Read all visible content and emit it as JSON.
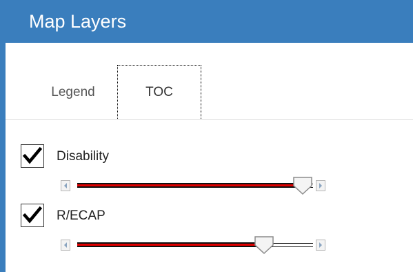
{
  "header": {
    "title": "Map Layers"
  },
  "tabs": [
    {
      "label": "Legend",
      "active": false
    },
    {
      "label": "TOC",
      "active": true
    }
  ],
  "layers": [
    {
      "label": "Disability",
      "checked": true,
      "opacity": 1.0
    },
    {
      "label": "R/ECAP",
      "checked": true,
      "opacity": 0.82
    }
  ],
  "colors": {
    "header": "#3a7ebd",
    "slider_fill": "#e10000"
  }
}
